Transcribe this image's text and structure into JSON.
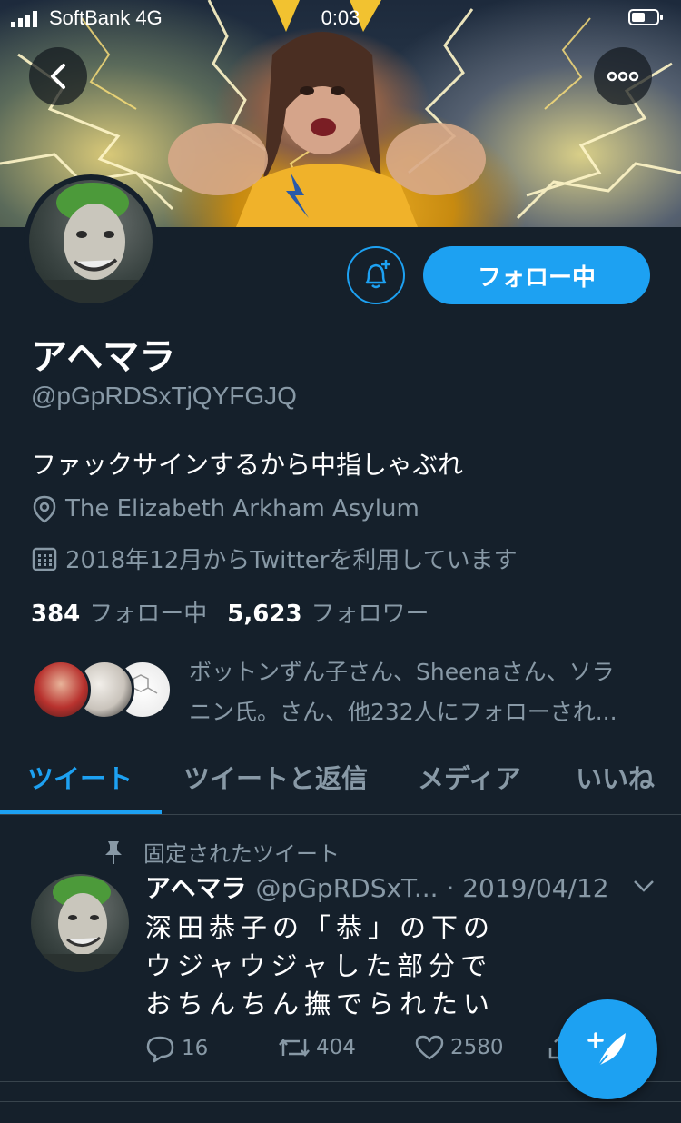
{
  "status_bar": {
    "carrier": "SoftBank 4G",
    "time": "0:03"
  },
  "profile": {
    "name": "アヘマラ",
    "handle": "@pGpRDSxTjQYFGJQ",
    "bio": "ファックサインするから中指しゃぶれ",
    "location": "The Elizabeth Arkham Asylum",
    "joined": "2018年12月からTwitterを利用しています",
    "following_count": "384",
    "following_label": "フォロー中",
    "followers_count": "5,623",
    "followers_label": "フォロワー",
    "followed_by_line1": "ボットンずん子さん、Sheenaさん、ソラ",
    "followed_by_line2": "ニン氏。さん、他232人にフォローされ..."
  },
  "buttons": {
    "follow": "フォロー中"
  },
  "tabs": [
    {
      "label": "ツイート",
      "active": true
    },
    {
      "label": "ツイートと返信",
      "active": false
    },
    {
      "label": "メディア",
      "active": false
    },
    {
      "label": "いいね",
      "active": false
    }
  ],
  "pinned_tweet": {
    "pinned_label": "固定されたツイート",
    "name": "アヘマラ",
    "handle_date": "@pGpRDSxT... · 2019/04/12",
    "line1": "深田恭子の「恭」の下の",
    "line2": "ウジャウジャした部分で",
    "line3": "おちんちん撫でられたい",
    "replies": "16",
    "retweets": "404",
    "likes": "2580"
  },
  "colors": {
    "accent": "#1da1f2",
    "background": "#15202b",
    "muted": "#8899a6"
  },
  "icons": [
    "back-arrow-icon",
    "more-icon",
    "bell-plus-icon",
    "location-pin-icon",
    "calendar-icon",
    "pin-icon",
    "chevron-down-icon",
    "reply-icon",
    "retweet-icon",
    "like-icon",
    "share-icon",
    "compose-icon"
  ]
}
